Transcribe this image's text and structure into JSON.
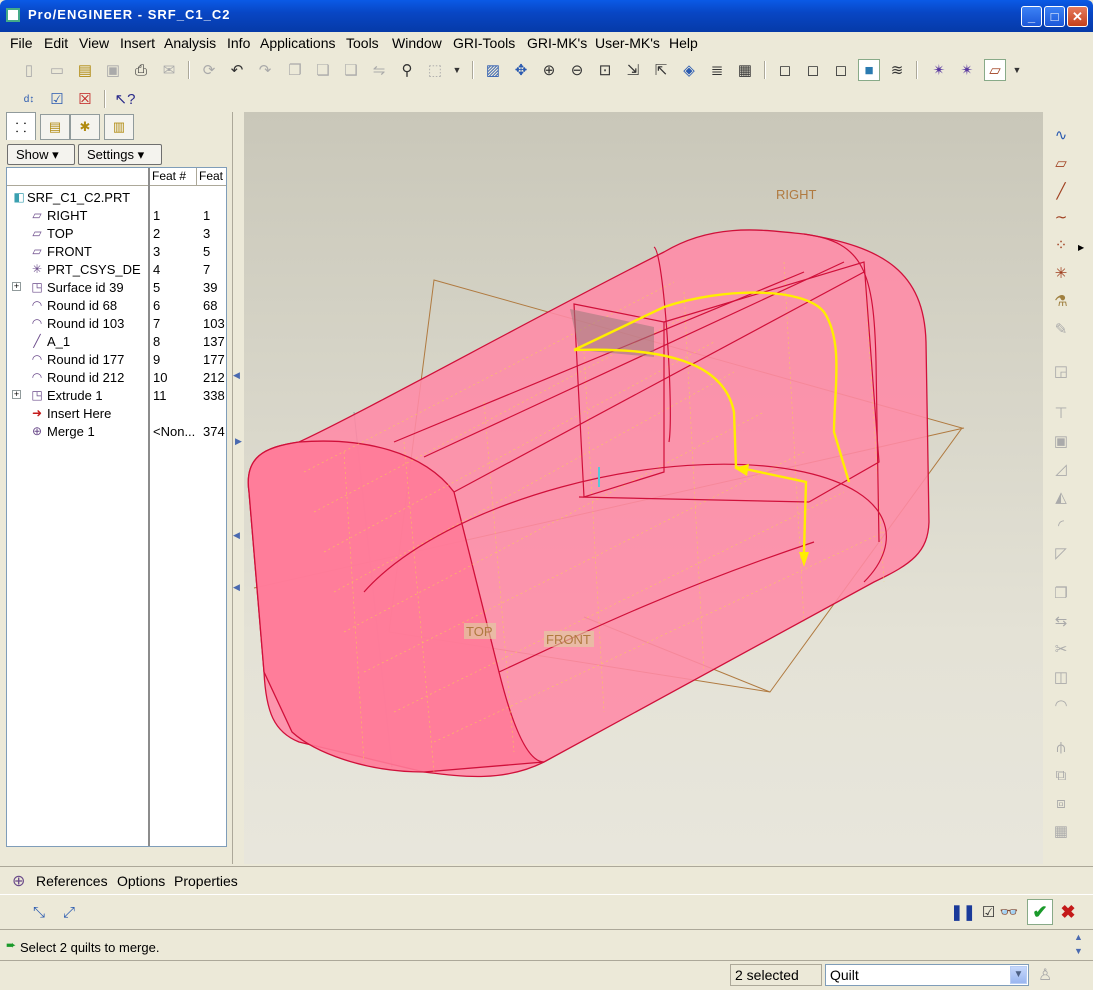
{
  "window": {
    "title": "Pro/ENGINEER - SRF_C1_C2"
  },
  "menu": [
    "File",
    "Edit",
    "View",
    "Insert",
    "Analysis",
    "Info",
    "Applications",
    "Tools",
    "Window",
    "GRI-Tools",
    "GRI-MK's",
    "User-MK's",
    "Help"
  ],
  "panel": {
    "show_label": "Show",
    "settings_label": "Settings",
    "col_feat_num": "Feat #",
    "col_feat": "Feat",
    "root": "SRF_C1_C2.PRT",
    "rows": [
      {
        "name": "RIGHT",
        "num": "1",
        "id": "1",
        "icon": "datum-plane-icon",
        "glyph": "▱"
      },
      {
        "name": "TOP",
        "num": "2",
        "id": "3",
        "icon": "datum-plane-icon",
        "glyph": "▱"
      },
      {
        "name": "FRONT",
        "num": "3",
        "id": "5",
        "icon": "datum-plane-icon",
        "glyph": "▱"
      },
      {
        "name": "PRT_CSYS_DE",
        "num": "4",
        "id": "7",
        "icon": "csys-icon",
        "glyph": "✳"
      },
      {
        "name": "Surface id 39",
        "num": "5",
        "id": "39",
        "icon": "surface-icon",
        "glyph": "◳",
        "expand": true
      },
      {
        "name": "Round id 68",
        "num": "6",
        "id": "68",
        "icon": "round-icon",
        "glyph": "◠"
      },
      {
        "name": "Round id 103",
        "num": "7",
        "id": "103",
        "icon": "round-icon",
        "glyph": "◠"
      },
      {
        "name": "A_1",
        "num": "8",
        "id": "137",
        "icon": "datum-axis-icon",
        "glyph": "╱"
      },
      {
        "name": "Round id 177",
        "num": "9",
        "id": "177",
        "icon": "round-icon",
        "glyph": "◠"
      },
      {
        "name": "Round id 212",
        "num": "10",
        "id": "212",
        "icon": "round-icon",
        "glyph": "◠"
      },
      {
        "name": "Extrude 1",
        "num": "11",
        "id": "338",
        "icon": "extrude-icon",
        "glyph": "◳",
        "expand": true
      },
      {
        "name": "Insert Here",
        "num": "",
        "id": "",
        "icon": "insert-here-arrow-icon",
        "glyph": "➜"
      },
      {
        "name": "Merge 1",
        "num": "<Non...",
        "id": "374",
        "icon": "merge-icon",
        "glyph": "⊕"
      }
    ]
  },
  "viewport": {
    "datum_labels": {
      "right": "RIGHT",
      "top": "TOP",
      "front": "FRONT"
    },
    "colors": {
      "quilt_fill": "#ff8aa6",
      "quilt_edge": "#d0103a",
      "highlight": "#ffee00",
      "datum": "#b07a40"
    }
  },
  "dashboard": {
    "tabs": [
      "References",
      "Options",
      "Properties"
    ]
  },
  "message": "Select 2 quilts to merge.",
  "status": {
    "selected": "2 selected",
    "filter": "Quilt"
  }
}
